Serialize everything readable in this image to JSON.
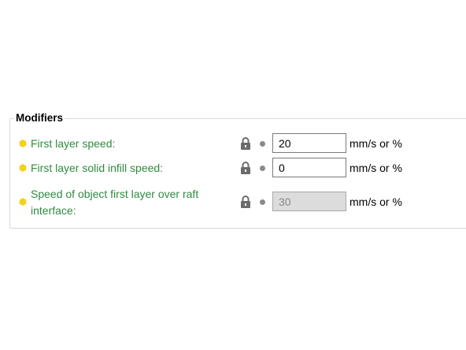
{
  "group": {
    "title": "Modifiers"
  },
  "rows": [
    {
      "label": "First layer speed:",
      "value": "20",
      "unit": "mm/s or %",
      "enabled": true
    },
    {
      "label": "First layer solid infill speed:",
      "value": "0",
      "unit": "mm/s or %",
      "enabled": true
    },
    {
      "label_line1": "Speed of object first layer over raft",
      "label_line2": "interface:",
      "value": "30",
      "unit": "mm/s or %",
      "enabled": false
    }
  ],
  "colors": {
    "label_green": "#2e8b3e",
    "bullet_yellow": "#f2d21b",
    "lock_gray": "#6b6b6b",
    "dot_gray": "#8a8a8a"
  },
  "icons": {
    "bullet": "hexagon-bullet-icon",
    "lock": "lock-icon",
    "dot": "dot-icon"
  }
}
